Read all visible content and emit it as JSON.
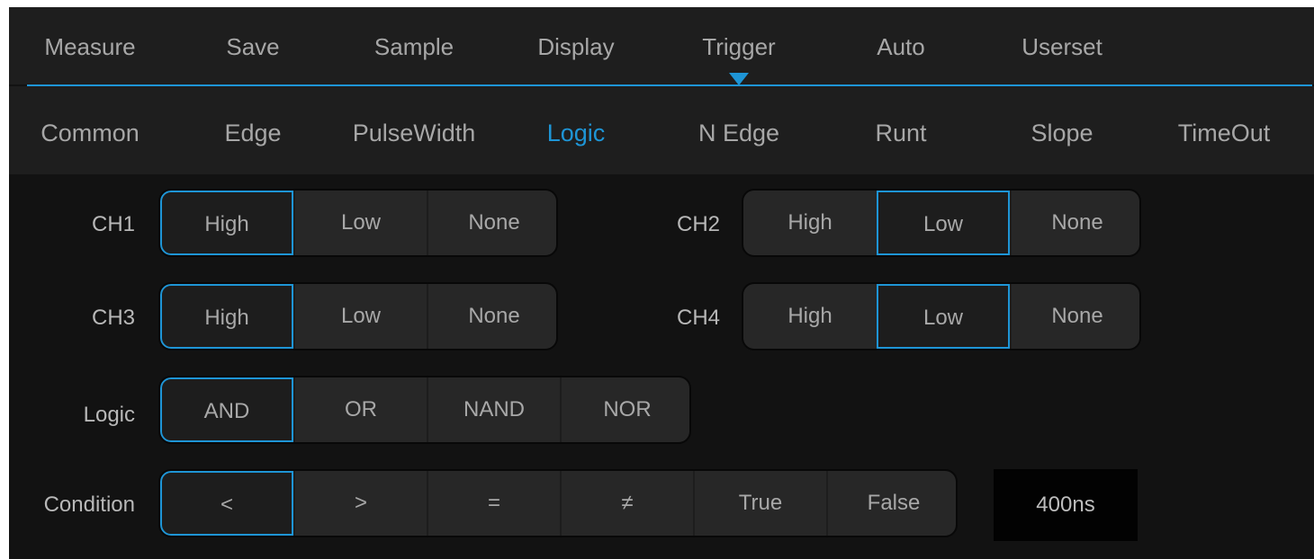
{
  "top_tabs": [
    "Measure",
    "Save",
    "Sample",
    "Display",
    "Trigger",
    "Auto",
    "Userset"
  ],
  "top_active": "Trigger",
  "sub_tabs": [
    "Common",
    "Edge",
    "PulseWidth",
    "Logic",
    "N Edge",
    "Runt",
    "Slope",
    "TimeOut"
  ],
  "sub_active": "Logic",
  "accent_color": "#1e95d6",
  "channels": {
    "ch1": {
      "label": "CH1",
      "options": [
        "High",
        "Low",
        "None"
      ],
      "selected": "High"
    },
    "ch2": {
      "label": "CH2",
      "options": [
        "High",
        "Low",
        "None"
      ],
      "selected": "Low"
    },
    "ch3": {
      "label": "CH3",
      "options": [
        "High",
        "Low",
        "None"
      ],
      "selected": "High"
    },
    "ch4": {
      "label": "CH4",
      "options": [
        "High",
        "Low",
        "None"
      ],
      "selected": "Low"
    }
  },
  "logic": {
    "label": "Logic",
    "options": [
      "AND",
      "OR",
      "NAND",
      "NOR"
    ],
    "selected": "AND"
  },
  "condition": {
    "label": "Condition",
    "options": [
      "<",
      ">",
      "=",
      "≠",
      "True",
      "False"
    ],
    "selected": "<",
    "time_value": "400ns"
  }
}
